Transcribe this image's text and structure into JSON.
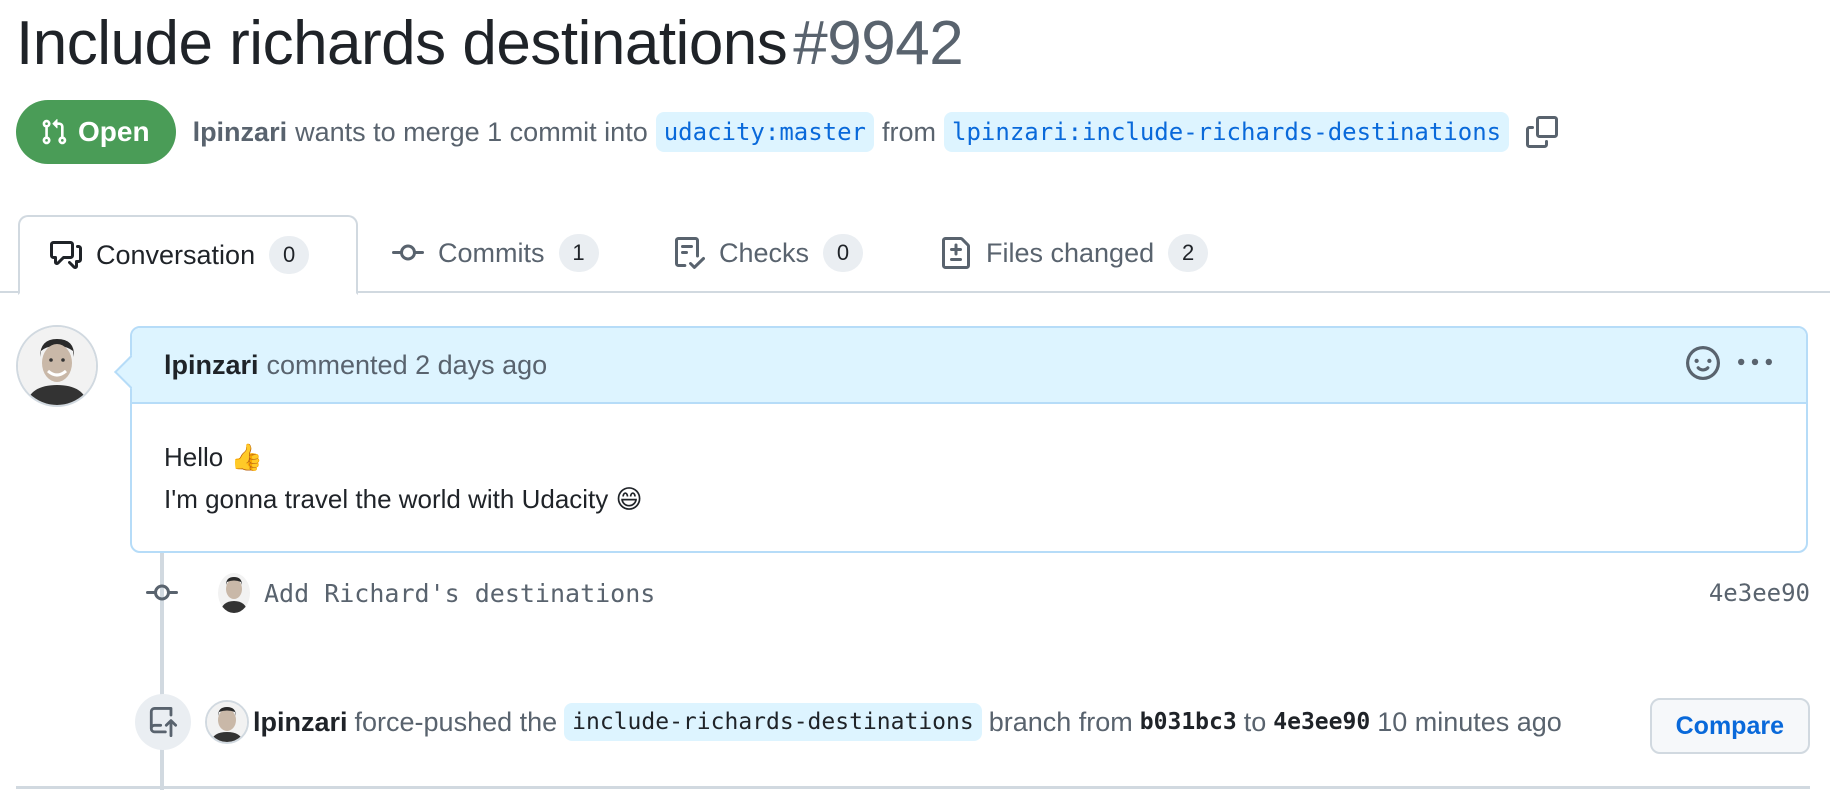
{
  "pr": {
    "title": "Include richards destinations",
    "number": "#9942",
    "state_label": "Open",
    "author": "lpinzari",
    "merge_text": "wants to merge 1 commit into",
    "base_branch": "udacity:master",
    "from_text": "from",
    "head_branch": "lpinzari:include-richards-destinations"
  },
  "tabs": [
    {
      "label": "Conversation",
      "count": "0",
      "icon": "comment-discussion-icon"
    },
    {
      "label": "Commits",
      "count": "1",
      "icon": "git-commit-icon"
    },
    {
      "label": "Checks",
      "count": "0",
      "icon": "checklist-icon"
    },
    {
      "label": "Files changed",
      "count": "2",
      "icon": "file-diff-icon"
    }
  ],
  "comment": {
    "author": "lpinzari",
    "meta": "commented 2 days ago",
    "line1": "Hello 👍",
    "line2": "I'm gonna travel the world with Udacity 😄"
  },
  "commit": {
    "message": "Add Richard's destinations",
    "sha": "4e3ee90"
  },
  "push_event": {
    "author": "lpinzari",
    "text1": "force-pushed the",
    "branch": "include-richards-destinations",
    "text2": "branch from",
    "from_sha": "b031bc3",
    "text3": "to",
    "to_sha": "4e3ee90",
    "time": "10 minutes ago",
    "compare_label": "Compare"
  },
  "colors": {
    "open_green": "#4a9c57",
    "link_blue": "#0969da",
    "comment_header_bg": "#ddf4ff"
  }
}
